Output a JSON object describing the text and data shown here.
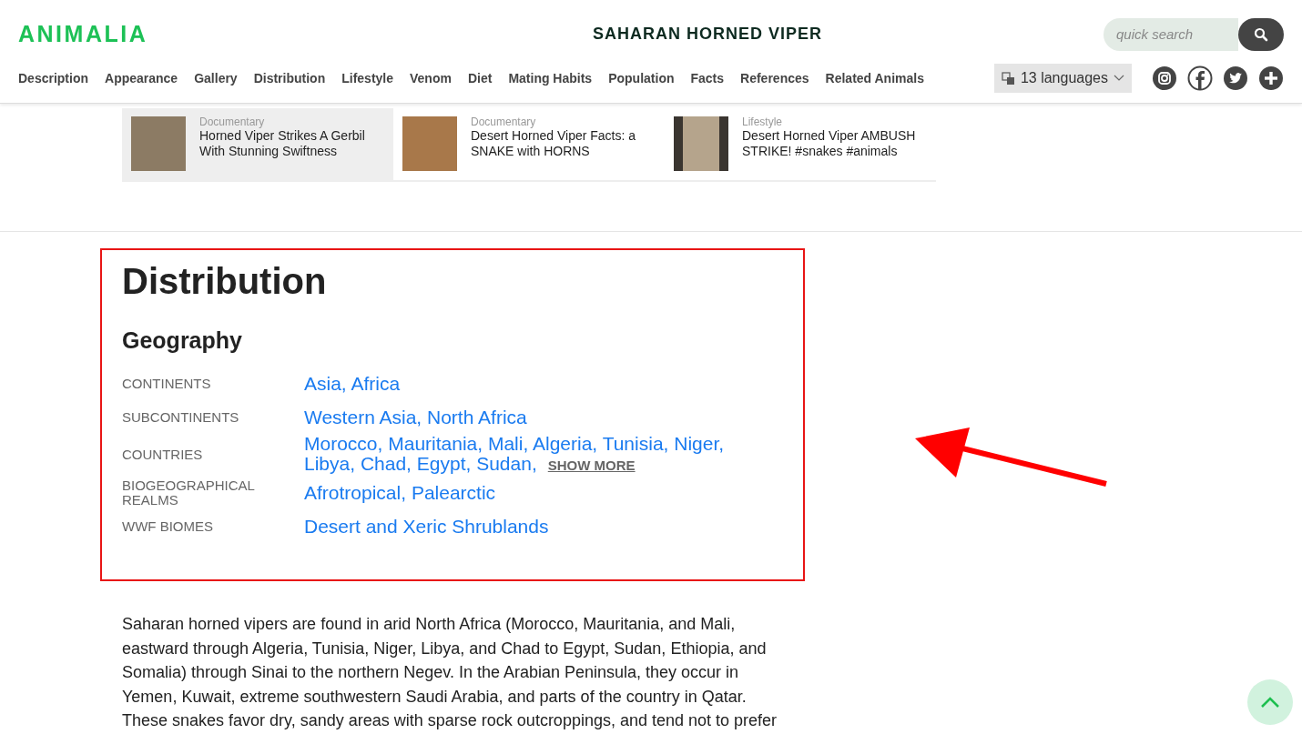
{
  "header": {
    "logo": "ANIMALIA",
    "title": "SAHARAN HORNED VIPER",
    "search": {
      "placeholder": "quick search"
    }
  },
  "nav": {
    "items": [
      "Description",
      "Appearance",
      "Gallery",
      "Distribution",
      "Lifestyle",
      "Venom",
      "Diet",
      "Mating Habits",
      "Population",
      "Facts",
      "References",
      "Related Animals"
    ],
    "languages": "13 languages"
  },
  "videos": [
    {
      "category": "Documentary",
      "title": "Horned Viper Strikes A Gerbil With Stunning Swiftness",
      "selected": true
    },
    {
      "category": "Documentary",
      "title": "Desert Horned Viper Facts: a SNAKE with HORNS",
      "selected": false
    },
    {
      "category": "Lifestyle",
      "title": "Desert Horned Viper AMBUSH STRIKE! #snakes #animals",
      "selected": false
    }
  ],
  "distribution": {
    "title": "Distribution",
    "subtitle": "Geography",
    "rows": [
      {
        "label": "CONTINENTS",
        "values": [
          "Asia,",
          "Africa"
        ]
      },
      {
        "label": "SUBCONTINENTS",
        "values": [
          "Western Asia,",
          "North Africa"
        ]
      },
      {
        "label": "COUNTRIES",
        "values": [
          "Morocco,",
          "Mauritania,",
          "Mali,",
          "Algeria,",
          "Tunisia,",
          "Niger,",
          "Libya,",
          "Chad,",
          "Egypt,",
          "Sudan,"
        ],
        "more": "SHOW MORE"
      },
      {
        "label": "BIOGEOGRAPHICAL REALMS",
        "values": [
          "Afrotropical,",
          "Palearctic"
        ]
      },
      {
        "label": "WWF BIOMES",
        "values": [
          "Desert and Xeric Shrublands"
        ]
      }
    ]
  },
  "paragraph": "Saharan horned vipers are found in arid North Africa (Morocco, Mauritania, and Mali, eastward through Algeria, Tunisia, Niger, Libya, and Chad to Egypt, Sudan, Ethiopia, and Somalia) through Sinai to the northern Negev. In the Arabian Peninsula, they occur in Yemen, Kuwait, extreme southwestern Saudi Arabia, and parts of the country in Qatar. These snakes favor dry, sandy areas with sparse rock outcroppings, and tend not to prefer"
}
